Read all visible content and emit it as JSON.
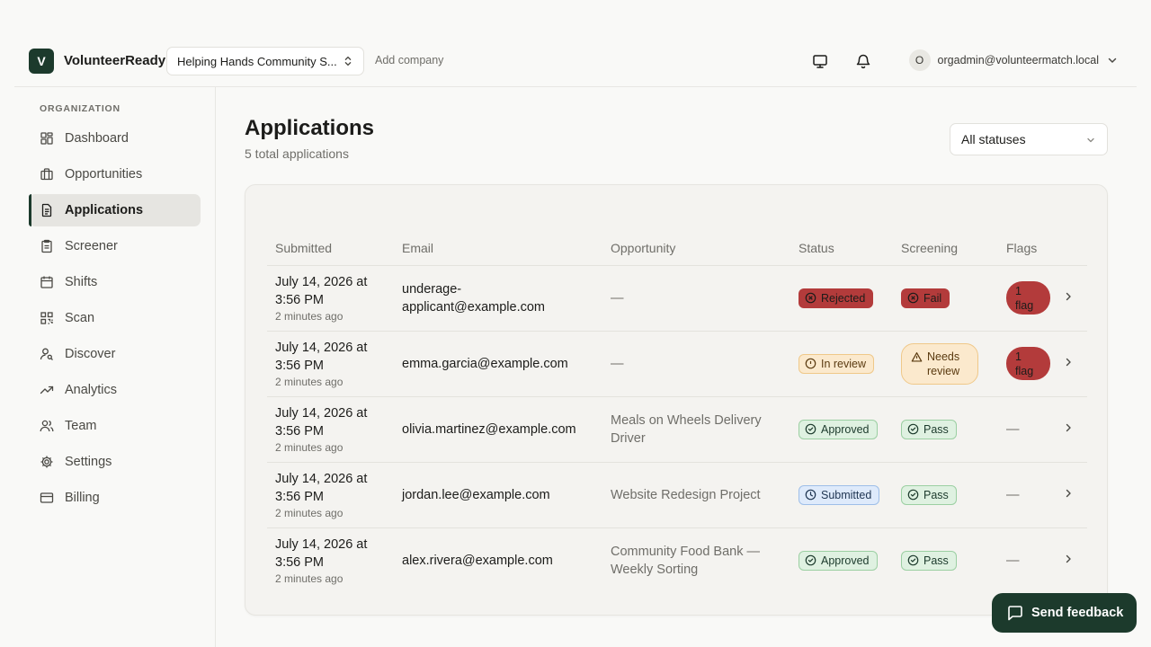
{
  "header": {
    "logo_letter": "V",
    "brand": "VolunteerReady",
    "org_selected": "Helping Hands Community S...",
    "add_company": "Add company",
    "user_initial": "O",
    "user_email": "orgadmin@volunteermatch.local"
  },
  "sidebar": {
    "heading": "ORGANIZATION",
    "items": [
      {
        "label": "Dashboard",
        "icon": "dashboard-icon"
      },
      {
        "label": "Opportunities",
        "icon": "briefcase-icon"
      },
      {
        "label": "Applications",
        "icon": "document-icon",
        "active": true
      },
      {
        "label": "Screener",
        "icon": "clipboard-icon"
      },
      {
        "label": "Shifts",
        "icon": "calendar-icon"
      },
      {
        "label": "Scan",
        "icon": "qr-code-icon"
      },
      {
        "label": "Discover",
        "icon": "user-search-icon"
      },
      {
        "label": "Analytics",
        "icon": "trending-up-icon"
      },
      {
        "label": "Team",
        "icon": "users-icon"
      },
      {
        "label": "Settings",
        "icon": "gear-icon"
      },
      {
        "label": "Billing",
        "icon": "credit-card-icon"
      }
    ]
  },
  "main": {
    "title": "Applications",
    "subtitle": "5 total applications",
    "status_filter": "All statuses",
    "columns": [
      "Submitted",
      "Email",
      "Opportunity",
      "Status",
      "Screening",
      "Flags"
    ],
    "rows": [
      {
        "date_line1": "July 14, 2026 at",
        "date_line2": "3:56 PM",
        "ago": "2 minutes ago",
        "email": "underage-applicant@example.com",
        "opportunity": "—",
        "status": "Rejected",
        "screening": "Fail",
        "flags": "1 flag"
      },
      {
        "date_line1": "July 14, 2026 at",
        "date_line2": "3:56 PM",
        "ago": "2 minutes ago",
        "email": "emma.garcia@example.com",
        "opportunity": "—",
        "status": "In review",
        "screening": "Needs review",
        "flags": "1 flag"
      },
      {
        "date_line1": "July 14, 2026 at",
        "date_line2": "3:56 PM",
        "ago": "2 minutes ago",
        "email": "olivia.martinez@example.com",
        "opportunity": "Meals on Wheels Delivery Driver",
        "status": "Approved",
        "screening": "Pass",
        "flags": "—"
      },
      {
        "date_line1": "July 14, 2026 at",
        "date_line2": "3:56 PM",
        "ago": "2 minutes ago",
        "email": "jordan.lee@example.com",
        "opportunity": "Website Redesign Project",
        "status": "Submitted",
        "screening": "Pass",
        "flags": "—"
      },
      {
        "date_line1": "July 14, 2026 at",
        "date_line2": "3:56 PM",
        "ago": "2 minutes ago",
        "email": "alex.rivera@example.com",
        "opportunity": "Community Food Bank — Weekly Sorting",
        "status": "Approved",
        "screening": "Pass",
        "flags": "—"
      }
    ]
  },
  "feedback_button": "Send feedback",
  "colors": {
    "brand": "#1c3a2c",
    "rejected": "#b33b3b",
    "approved_bg": "#dff1e1",
    "review_bg": "#fbe9cd",
    "submitted_bg": "#deeafb"
  }
}
